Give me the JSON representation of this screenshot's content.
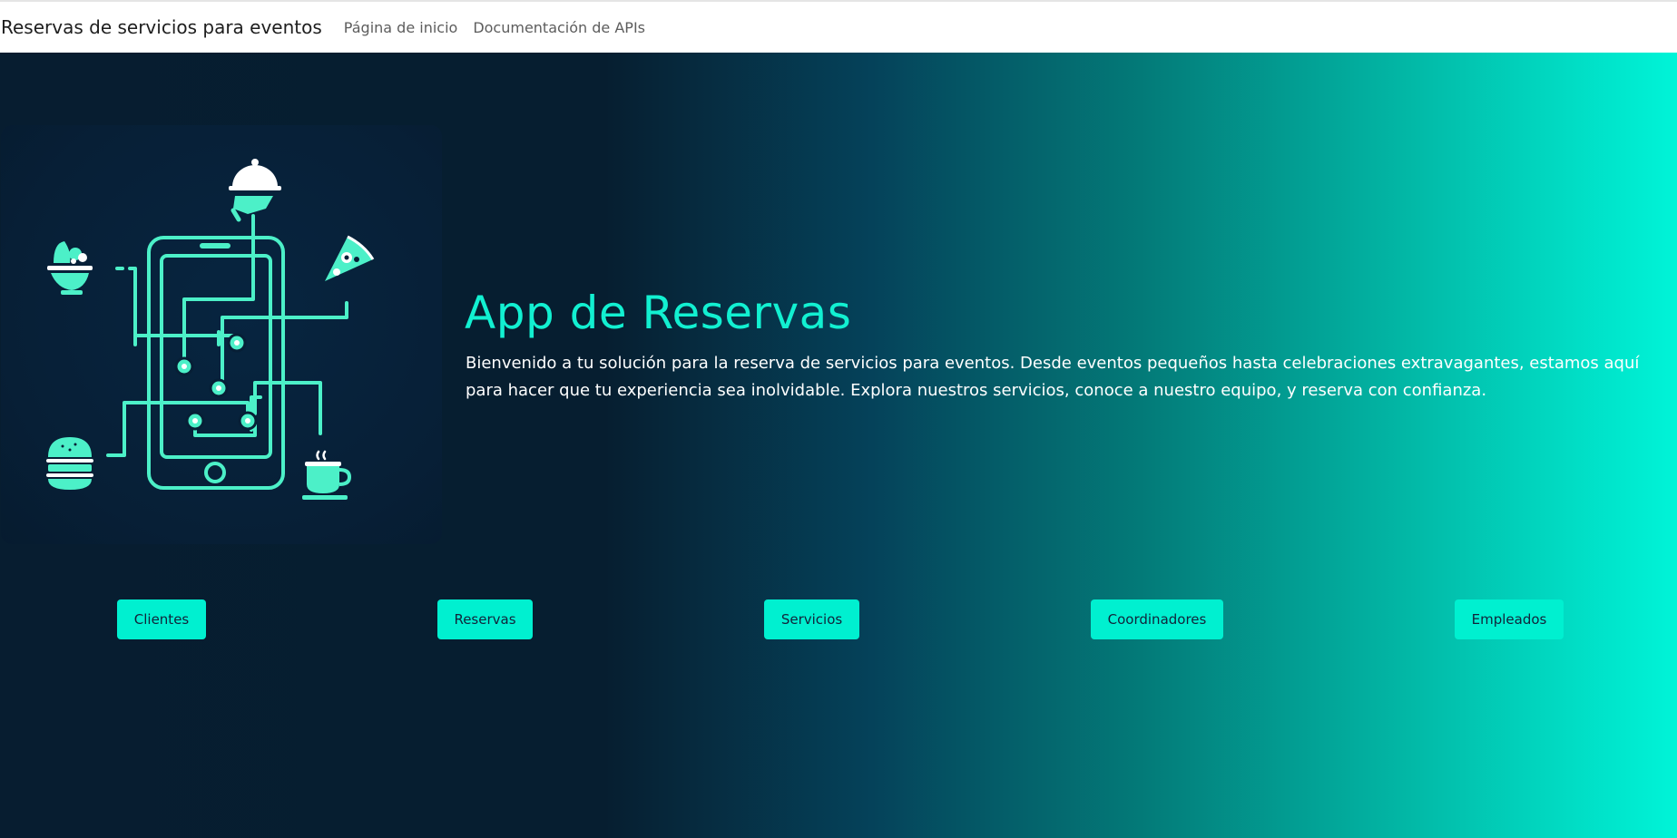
{
  "navbar": {
    "brand": "Reservas de servicios para eventos",
    "links": [
      "Página de inicio",
      "Documentación de APIs"
    ]
  },
  "hero": {
    "title": "App de Reservas",
    "description": "Bienvenido a tu solución para la reserva de servicios para eventos. Desde eventos pequeños hasta celebraciones extravagantes, estamos aquí para hacer que tu experiencia sea inolvidable. Explora nuestros servicios, conoce a nuestro equipo, y reserva con confianza."
  },
  "buttons": [
    "Clientes",
    "Reservas",
    "Servicios",
    "Coordinadores",
    "Empleados"
  ],
  "illustration": {
    "icons": [
      "cloche-icon",
      "salad-bowl-icon",
      "pizza-slice-icon",
      "burger-icon",
      "coffee-cup-icon",
      "smartphone-icon"
    ]
  },
  "colors": {
    "accent": "#00f0d0",
    "title": "#12f0d1",
    "illustration_line": "#4cf0c8",
    "gradient_start": "#071d30",
    "gradient_end": "#00f4d8"
  }
}
